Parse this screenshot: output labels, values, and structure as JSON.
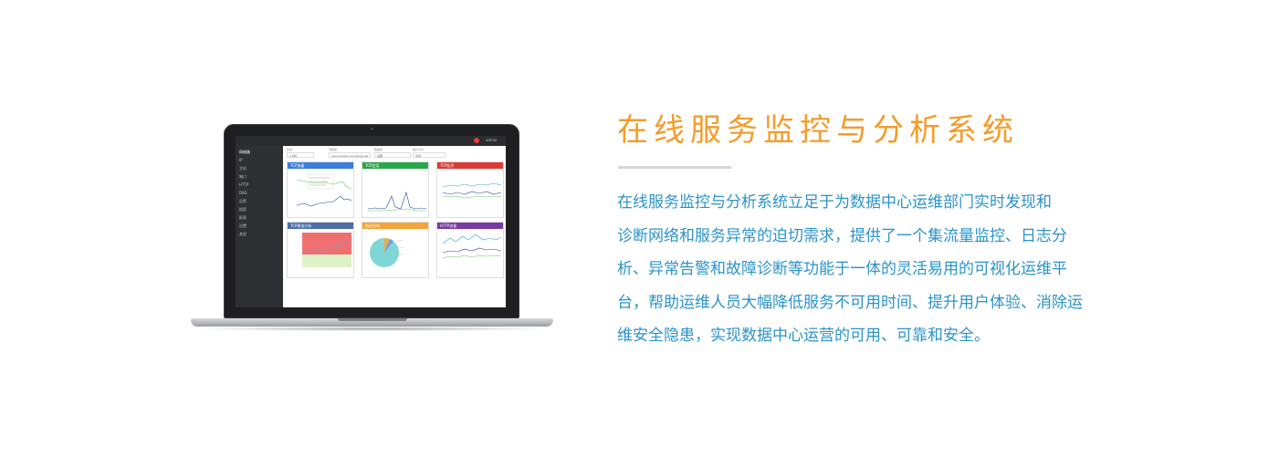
{
  "title": "在线服务监控与分析系统",
  "description_lines": [
    "在线服务监控与分析系统立足于为数据中心运维部门实时发现和",
    "诊断网络和服务异常的迫切需求，提供了一个集流量监控、日志分",
    "析、异常告警和故障诊断等功能于一体的灵活易用的可视化运维平",
    "台，帮助运维人员大幅降低服务不可用时间、提升用户体验、消除运",
    "维安全隐患，实现数据中心运营的可用、可靠和安全。"
  ],
  "colors": {
    "title": "#f39c2c",
    "description": "#2c93c9",
    "divider": "#d5d5d5"
  },
  "screen": {
    "sidebar_items": [
      "网络路",
      "IP",
      "主机",
      "端口",
      "HTTP",
      "DNS",
      "告警",
      "搜索",
      "报表",
      "设置",
      "其他"
    ],
    "user": "admin",
    "filters": [
      {
        "label": "时间",
        "value": "1小时"
      },
      {
        "label": "流量源",
        "value": "cloud.sunet.com.group.net"
      },
      {
        "label": "数据源",
        "value": "全部"
      },
      {
        "label": "统计方式",
        "value": "平均"
      }
    ],
    "panels": [
      {
        "title": "TCP流量",
        "color": "#3b7ddd"
      },
      {
        "title": "TCP会话",
        "color": "#2aa64a"
      },
      {
        "title": "TCP乱序",
        "color": "#d93c34"
      },
      {
        "title": "TCP建连分析",
        "color": "#4a6ea8"
      },
      {
        "title": "协议分布",
        "color": "#f3a43a"
      },
      {
        "title": "HTTP流量",
        "color": "#7a3aa3"
      }
    ]
  }
}
